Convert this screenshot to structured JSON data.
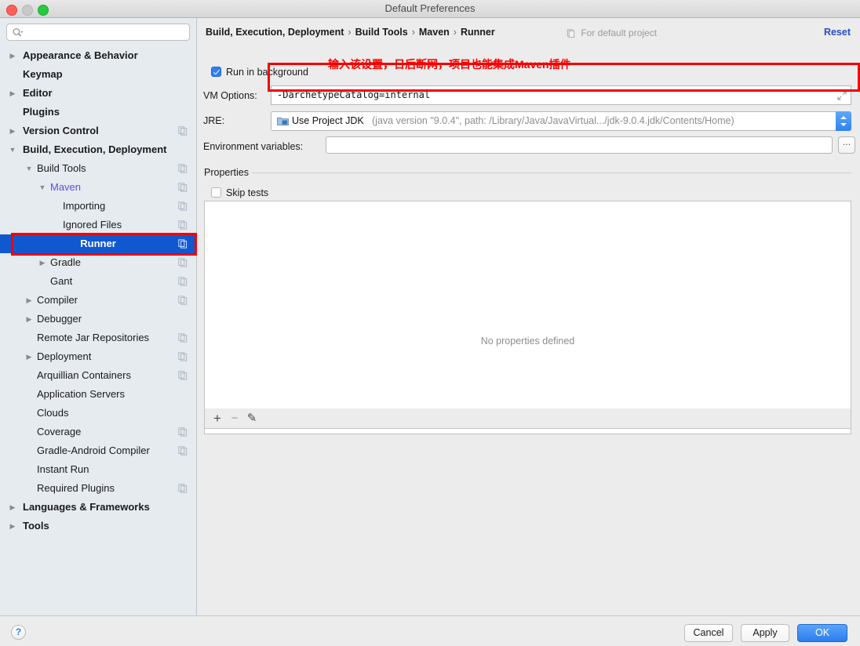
{
  "window": {
    "title": "Default Preferences",
    "traffic_lights": [
      "close-button",
      "minimize-button",
      "maximize-button"
    ]
  },
  "sidebar": {
    "search": {
      "placeholder": "",
      "value": "",
      "icon": "search-icon"
    },
    "items": [
      {
        "label": "Appearance & Behavior",
        "level": 0,
        "twisty": "▶",
        "bold": true,
        "copy": false
      },
      {
        "label": "Keymap",
        "level": 0,
        "twisty": "",
        "bold": true,
        "copy": false
      },
      {
        "label": "Editor",
        "level": 0,
        "twisty": "▶",
        "bold": true,
        "copy": false
      },
      {
        "label": "Plugins",
        "level": 0,
        "twisty": "",
        "bold": true,
        "copy": false
      },
      {
        "label": "Version Control",
        "level": 0,
        "twisty": "▶",
        "bold": true,
        "copy": true
      },
      {
        "label": "Build, Execution, Deployment",
        "level": 0,
        "twisty": "▼",
        "bold": true,
        "copy": false
      },
      {
        "label": "Build Tools",
        "level": 1,
        "twisty": "▼",
        "bold": false,
        "copy": true
      },
      {
        "label": "Maven",
        "level": 2,
        "twisty": "▼",
        "bold": false,
        "copy": true,
        "accent": true
      },
      {
        "label": "Importing",
        "level": 3,
        "twisty": "",
        "bold": false,
        "copy": true
      },
      {
        "label": "Ignored Files",
        "level": 3,
        "twisty": "",
        "bold": false,
        "copy": true
      },
      {
        "label": "Runner",
        "level": 3,
        "twisty": "",
        "bold": false,
        "copy": true,
        "selected": true
      },
      {
        "label": "Gradle",
        "level": 2,
        "twisty": "▶",
        "bold": false,
        "copy": true
      },
      {
        "label": "Gant",
        "level": 2,
        "twisty": "",
        "bold": false,
        "copy": true
      },
      {
        "label": "Compiler",
        "level": 1,
        "twisty": "▶",
        "bold": false,
        "copy": true
      },
      {
        "label": "Debugger",
        "level": 1,
        "twisty": "▶",
        "bold": false,
        "copy": false
      },
      {
        "label": "Remote Jar Repositories",
        "level": 1,
        "twisty": "",
        "bold": false,
        "copy": true
      },
      {
        "label": "Deployment",
        "level": 1,
        "twisty": "▶",
        "bold": false,
        "copy": true
      },
      {
        "label": "Arquillian Containers",
        "level": 1,
        "twisty": "",
        "bold": false,
        "copy": true
      },
      {
        "label": "Application Servers",
        "level": 1,
        "twisty": "",
        "bold": false,
        "copy": false
      },
      {
        "label": "Clouds",
        "level": 1,
        "twisty": "",
        "bold": false,
        "copy": false
      },
      {
        "label": "Coverage",
        "level": 1,
        "twisty": "",
        "bold": false,
        "copy": true
      },
      {
        "label": "Gradle-Android Compiler",
        "level": 1,
        "twisty": "",
        "bold": false,
        "copy": true
      },
      {
        "label": "Instant Run",
        "level": 1,
        "twisty": "",
        "bold": false,
        "copy": false
      },
      {
        "label": "Required Plugins",
        "level": 1,
        "twisty": "",
        "bold": false,
        "copy": true
      },
      {
        "label": "Languages & Frameworks",
        "level": 0,
        "twisty": "▶",
        "bold": true,
        "copy": false
      },
      {
        "label": "Tools",
        "level": 0,
        "twisty": "▶",
        "bold": true,
        "copy": false
      }
    ]
  },
  "main": {
    "breadcrumb": {
      "items": [
        "Build, Execution, Deployment",
        "Build Tools",
        "Maven",
        "Runner"
      ],
      "separator": "›"
    },
    "for_default_project": "For default project",
    "reset_label": "Reset",
    "run_in_background": {
      "label": "Run in background",
      "checked": true
    },
    "vm_options": {
      "label": "VM Options:",
      "value": "-DarchetypeCatalog=internal",
      "expand_icon": "expand-icon"
    },
    "jre": {
      "label": "JRE:",
      "name": "Use Project JDK",
      "detail": "(java version \"9.0.4\", path: /Library/Java/JavaVirtual.../jdk-9.0.4.jdk/Contents/Home)"
    },
    "environment_variables": {
      "label": "Environment variables:",
      "value": "",
      "browse_label": "…"
    },
    "properties": {
      "section_label": "Properties",
      "skip_tests": {
        "label": "Skip tests",
        "checked": false
      },
      "empty_message": "No properties defined",
      "toolbar": {
        "add": "+",
        "remove": "−",
        "edit": "✎"
      }
    }
  },
  "footer": {
    "help_label": "?",
    "cancel_label": "Cancel",
    "apply_label": "Apply",
    "ok_label": "OK"
  },
  "annotations": {
    "note_text": "输入该设置，日后断网，项目也能集成Maven插件",
    "note_color": "#ff0000",
    "box_color": "#f50000"
  },
  "colors": {
    "accent_blue": "#2f7ef5",
    "selection_blue": "#1058d0",
    "maven_purple": "#5a4fe0",
    "sidebar_bg": "#e6ebf0",
    "panel_bg": "#ececec"
  }
}
